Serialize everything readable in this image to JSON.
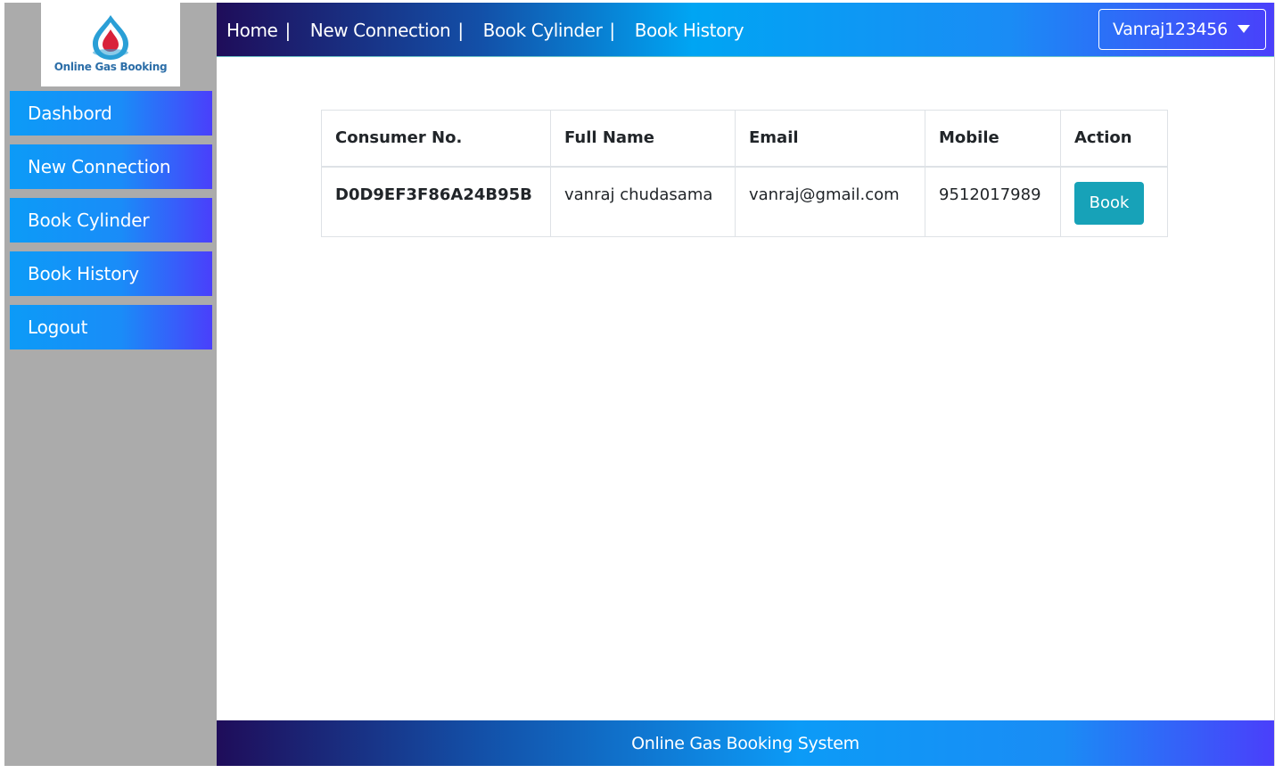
{
  "logo": {
    "text": "Online Gas Booking",
    "colors": {
      "flame": "#d9223a",
      "ring": "#2a9fd6"
    }
  },
  "sidebar": {
    "items": [
      {
        "label": "Dashbord"
      },
      {
        "label": "New Connection"
      },
      {
        "label": "Book Cylinder"
      },
      {
        "label": "Book History"
      },
      {
        "label": "Logout"
      }
    ]
  },
  "topnav": {
    "links": [
      {
        "label": "Home"
      },
      {
        "label": "New Connection"
      },
      {
        "label": "Book Cylinder"
      },
      {
        "label": "Book History"
      }
    ],
    "separator": "|",
    "user": "Vanraj123456"
  },
  "table": {
    "headers": [
      "Consumer No.",
      "Full Name",
      "Email",
      "Mobile",
      "Action"
    ],
    "rows": [
      {
        "consumer_no": "D0D9EF3F86A24B95B",
        "full_name": "vanraj chudasama",
        "email": "vanraj@gmail.com",
        "mobile": "9512017989",
        "action": "Book"
      }
    ]
  },
  "footer": {
    "text": "Online Gas Booking System"
  },
  "colors": {
    "sidebar_bg": "#ababab",
    "nav_gradient_start": "#1f0d5a",
    "nav_gradient_end": "#4a3ffb",
    "book_button": "#17a2b8"
  }
}
